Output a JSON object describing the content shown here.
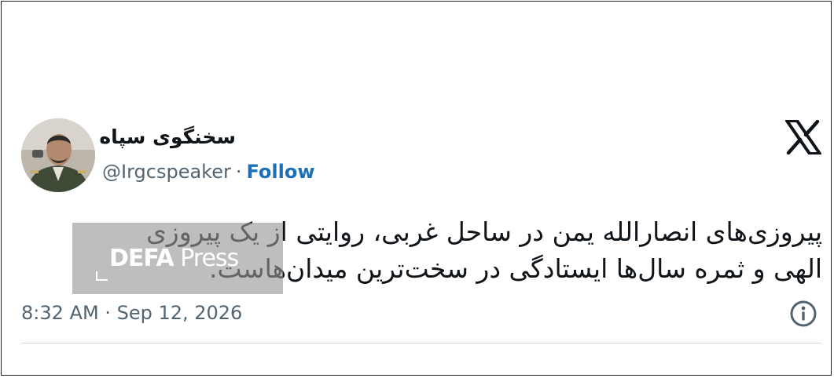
{
  "tweet": {
    "display_name": "سخنگوی سپاه",
    "handle": "@Irgcspeaker",
    "separator": "·",
    "follow_label": "Follow",
    "text_lines": [
      "پیروزی‌های انصارالله یمن در ساحل غربی، روایتی از یک پیروزی",
      "الهی و ثمره سال‌ها ایستادگی در سخت‌ترین میدان‌هاست."
    ],
    "time": "8:32 AM",
    "date": "Sep 12, 2026",
    "brand_icon": "x-logo-icon",
    "info_icon": "info-icon"
  },
  "watermark": {
    "brand": "DEFA",
    "suffix": " Press"
  },
  "colors": {
    "text": "#0f1419",
    "muted": "#536471",
    "follow": "#1d6fb8",
    "divider": "#cfd9de"
  }
}
